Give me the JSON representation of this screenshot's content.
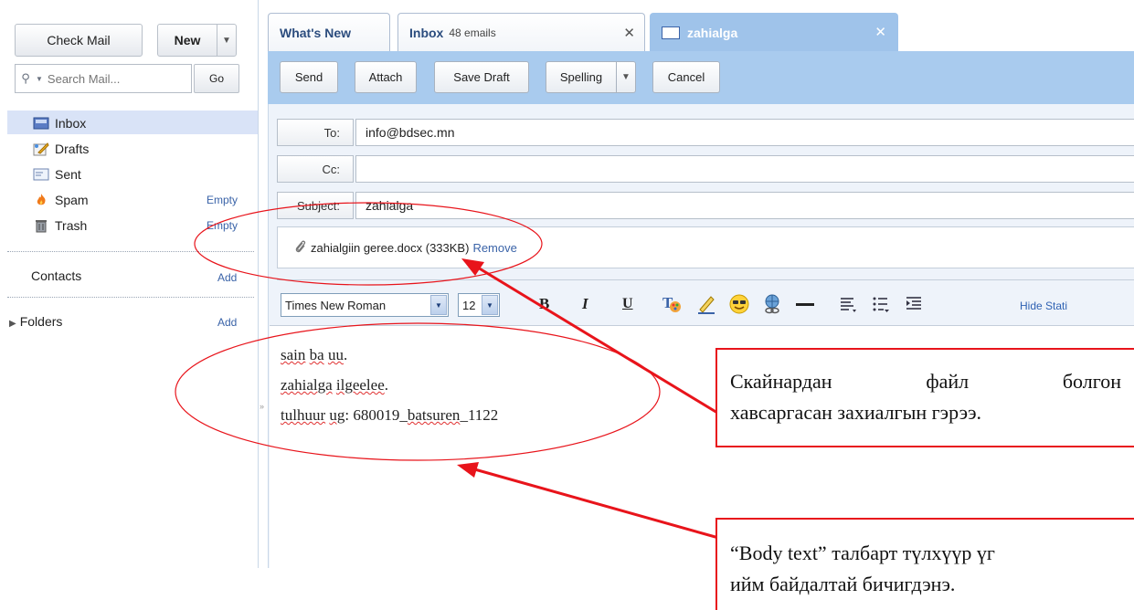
{
  "sidebar": {
    "check_mail": "Check Mail",
    "new_label": "New",
    "search_placeholder": "Search Mail...",
    "go_label": "Go",
    "folders": [
      {
        "label": "Inbox",
        "icon": "inbox-icon"
      },
      {
        "label": "Drafts",
        "icon": "drafts-icon"
      },
      {
        "label": "Sent",
        "icon": "sent-icon"
      },
      {
        "label": "Spam",
        "icon": "spam-icon",
        "action": "Empty"
      },
      {
        "label": "Trash",
        "icon": "trash-icon",
        "action": "Empty"
      }
    ],
    "contacts_label": "Contacts",
    "contacts_action": "Add",
    "folders_label": "Folders",
    "folders_action": "Add"
  },
  "tabs": {
    "whats_new": "What's New",
    "inbox_label": "Inbox",
    "inbox_count": "48 emails",
    "compose_label": "zahialga"
  },
  "toolbar": {
    "send": "Send",
    "attach": "Attach",
    "save_draft": "Save Draft",
    "spelling": "Spelling",
    "cancel": "Cancel"
  },
  "compose": {
    "to_label": "To:",
    "to_value": "info@bdsec.mn",
    "cc_label": "Cc:",
    "cc_value": "",
    "subject_label": "Subject:",
    "subject_value": "zahialga",
    "attachment_name": "zahialgiin geree.docx (333KB)",
    "attachment_remove": "Remove"
  },
  "format_bar": {
    "font": "Times New Roman",
    "size": "12",
    "bold": "B",
    "italic": "I",
    "underline": "U",
    "hide_status": "Hide Stati"
  },
  "body": {
    "line1_a": "sain",
    "line1_b": "ba",
    "line1_c": "uu",
    "line1_end": ".",
    "line2_a": "zahialga",
    "line2_b": "ilgeelee",
    "line2_end": ".",
    "line3_a": "tulhuur",
    "line3_b": "ug",
    "line3_rest": ": 680019_",
    "line3_c": "batsuren",
    "line3_end": "_1122"
  },
  "annotations": {
    "callout1_line1": "Скайнардан файл болгон",
    "callout1_line2": "хавсаргасан захиалгын гэрээ.",
    "callout2_line1": "“Body text” талбарт түлхүүр үг",
    "callout2_line2": "ийм байдалтай бичигдэнэ."
  },
  "colors": {
    "accent_band": "#a9cbee",
    "active_tab": "#9fc3ea",
    "link": "#3a63a8",
    "annotation_red": "#e8141b"
  }
}
